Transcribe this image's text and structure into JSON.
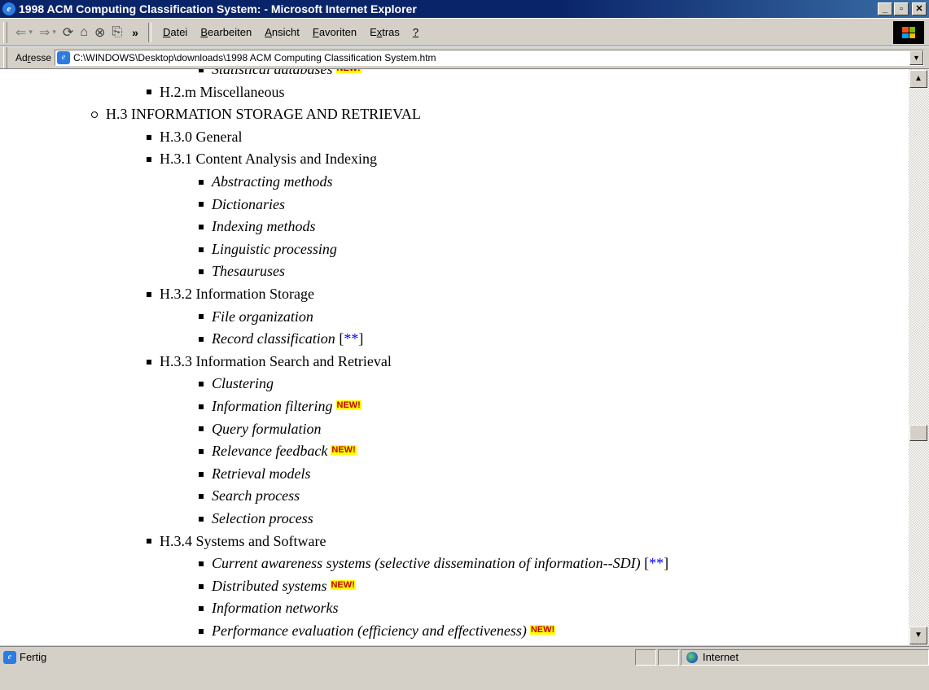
{
  "window": {
    "title": "1998 ACM Computing Classification System: - Microsoft Internet Explorer",
    "minimize": "_",
    "maximize": "▫",
    "close": "✕"
  },
  "toolbar": {
    "chevron": "»",
    "menu": [
      "Datei",
      "Bearbeiten",
      "Ansicht",
      "Favoriten",
      "Extras",
      "?"
    ],
    "menu_access": [
      "D",
      "B",
      "A",
      "F",
      "x",
      "?"
    ]
  },
  "address": {
    "label": "Adresse",
    "url": "C:\\WINDOWS\\Desktop\\downloads\\1998 ACM Computing Classification System.htm"
  },
  "content": {
    "new_badge": "NEW!",
    "lines": [
      {
        "level": 3,
        "text": "Statistical databases",
        "italic": true,
        "new": true,
        "partial": true
      },
      {
        "level": 2,
        "text": "H.2.m Miscellaneous"
      },
      {
        "level": 1,
        "text": "H.3 INFORMATION STORAGE AND RETRIEVAL"
      },
      {
        "level": 2,
        "text": "H.3.0 General"
      },
      {
        "level": 2,
        "text": "H.3.1 Content Analysis and Indexing"
      },
      {
        "level": 3,
        "text": "Abstracting methods",
        "italic": true
      },
      {
        "level": 3,
        "text": "Dictionaries",
        "italic": true
      },
      {
        "level": 3,
        "text": "Indexing methods",
        "italic": true
      },
      {
        "level": 3,
        "text": "Linguistic processing",
        "italic": true
      },
      {
        "level": 3,
        "text": "Thesauruses",
        "italic": true
      },
      {
        "level": 2,
        "text": "H.3.2 Information Storage"
      },
      {
        "level": 3,
        "text": "File organization",
        "italic": true
      },
      {
        "level": 3,
        "text": "Record classification",
        "italic": true,
        "ref": "**"
      },
      {
        "level": 2,
        "text": "H.3.3 Information Search and Retrieval"
      },
      {
        "level": 3,
        "text": "Clustering",
        "italic": true
      },
      {
        "level": 3,
        "text": "Information filtering",
        "italic": true,
        "new": true
      },
      {
        "level": 3,
        "text": "Query formulation",
        "italic": true
      },
      {
        "level": 3,
        "text": "Relevance feedback",
        "italic": true,
        "new": true
      },
      {
        "level": 3,
        "text": "Retrieval models",
        "italic": true
      },
      {
        "level": 3,
        "text": "Search process",
        "italic": true
      },
      {
        "level": 3,
        "text": "Selection process",
        "italic": true
      },
      {
        "level": 2,
        "text": "H.3.4 Systems and Software"
      },
      {
        "level": 3,
        "text": "Current awareness systems (selective dissemination of information--SDI)",
        "italic": true,
        "ref": "**"
      },
      {
        "level": 3,
        "text": "Distributed systems",
        "italic": true,
        "new": true
      },
      {
        "level": 3,
        "text": "Information networks",
        "italic": true
      },
      {
        "level": 3,
        "text": "Performance evaluation (efficiency and effectiveness)",
        "italic": true,
        "new": true,
        "partial": true
      }
    ]
  },
  "status": {
    "text": "Fertig",
    "zone": "Internet"
  }
}
